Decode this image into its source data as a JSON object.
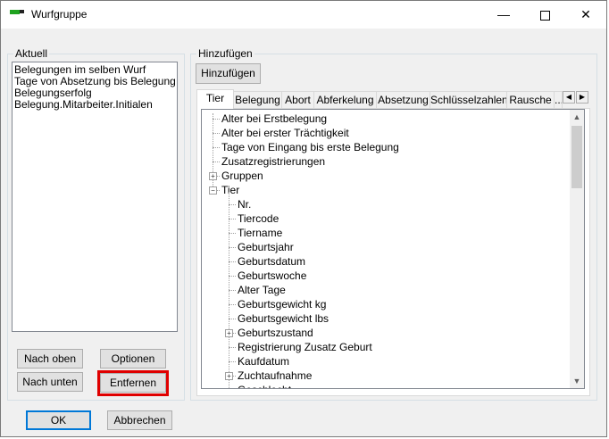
{
  "window": {
    "title": "Wurfgruppe"
  },
  "aktuell": {
    "label": "Aktuell",
    "items": [
      "Belegungen im selben Wurf",
      "Tage von Absetzung bis Belegung",
      "Belegungserfolg",
      "Belegung.Mitarbeiter.Initialen"
    ],
    "btn_nach_oben": "Nach oben",
    "btn_optionen": "Optionen",
    "btn_nach_unten": "Nach unten",
    "btn_entfernen": "Entfernen"
  },
  "hinzufuegen": {
    "label": "Hinzufügen",
    "btn": "Hinzufügen",
    "tabs": [
      "Tier",
      "Belegung",
      "Abort",
      "Abferkelung",
      "Absetzung",
      "Schlüsselzahlen",
      "Rausche"
    ],
    "tab_overflow": "..."
  },
  "tree": {
    "root_items": [
      "Alter bei Erstbelegung",
      "Alter bei erster Trächtigkeit",
      "Tage von Eingang bis erste Belegung",
      "Zusatzregistrierungen",
      "Gruppen",
      "Tier"
    ],
    "tier_children": [
      "Nr.",
      "Tiercode",
      "Tiername",
      "Geburtsjahr",
      "Geburtsdatum",
      "Geburtswoche",
      "Alter Tage",
      "Geburtsgewicht kg",
      "Geburtsgewicht lbs",
      "Geburtszustand",
      "Registrierung Zusatz Geburt",
      "Kaufdatum",
      "Zuchtaufnahme",
      "Geschlecht"
    ]
  },
  "footer": {
    "ok": "OK",
    "cancel": "Abbrechen"
  }
}
